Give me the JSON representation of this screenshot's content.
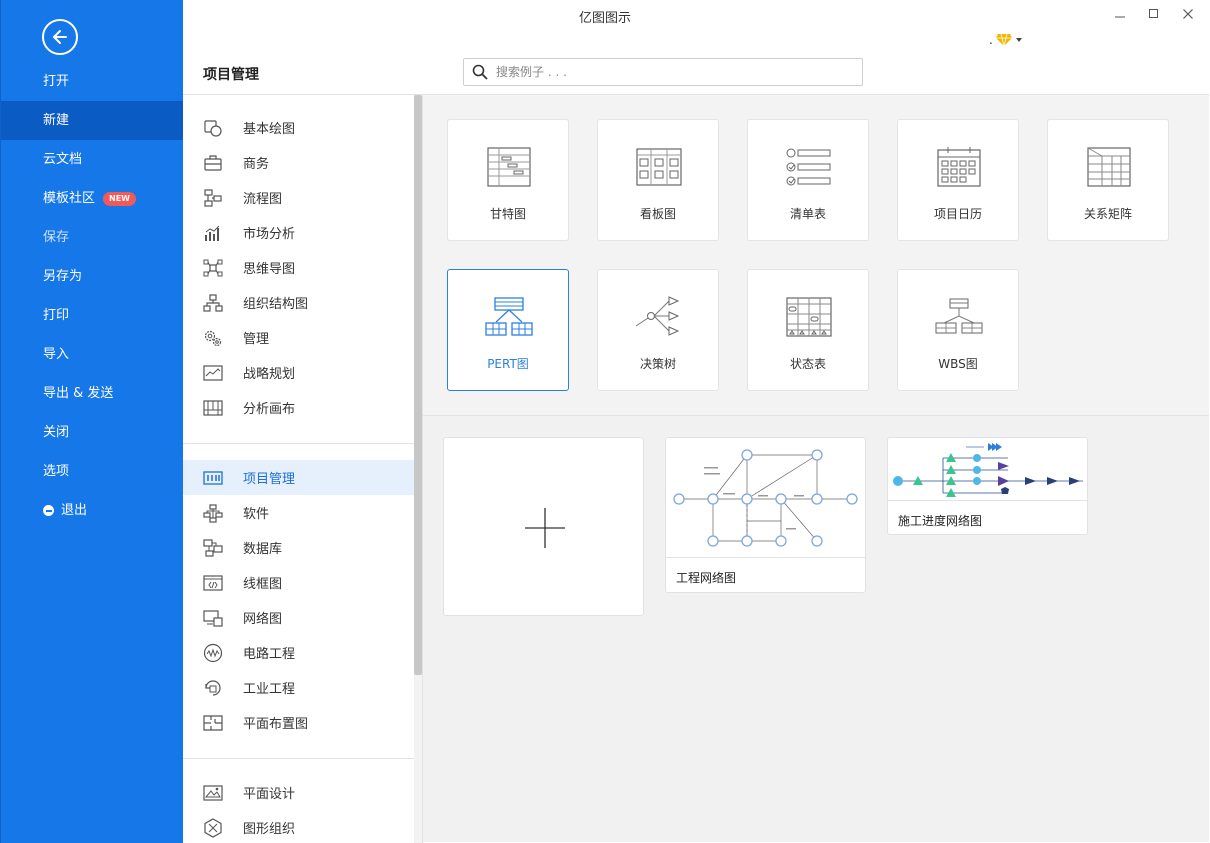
{
  "window": {
    "title": "亿图图示",
    "minimize_glyph": "—",
    "maximize_glyph": "☐",
    "close_glyph": "✕"
  },
  "premium": {
    "icon": "diamond-icon",
    "dot": ".",
    "color": "#f5b400"
  },
  "left_menu": {
    "back_icon": "back-arrow-icon",
    "items": [
      {
        "label": "打开"
      },
      {
        "label": "新建",
        "active": true
      },
      {
        "label": "云文档"
      },
      {
        "label": "模板社区",
        "badge": "NEW"
      },
      {
        "label": "保存",
        "dim": true
      },
      {
        "label": "另存为"
      },
      {
        "label": "打印"
      },
      {
        "label": "导入"
      },
      {
        "label": "导出 & 发送"
      },
      {
        "label": "关闭"
      },
      {
        "label": "选项"
      },
      {
        "label": "退出",
        "icon": "exit-icon"
      }
    ],
    "accent": "#1677e8"
  },
  "header": {
    "section_title": "项目管理",
    "search_placeholder": "搜索例子 . . ."
  },
  "categories": {
    "group1": [
      {
        "label": "基本绘图",
        "icon": "basic-shapes-icon"
      },
      {
        "label": "商务",
        "icon": "briefcase-icon"
      },
      {
        "label": "流程图",
        "icon": "flowchart-icon"
      },
      {
        "label": "市场分析",
        "icon": "bar-chart-icon"
      },
      {
        "label": "思维导图",
        "icon": "mindmap-icon"
      },
      {
        "label": "组织结构图",
        "icon": "org-chart-icon"
      },
      {
        "label": "管理",
        "icon": "gears-icon"
      },
      {
        "label": "战略规划",
        "icon": "line-chart-icon"
      },
      {
        "label": "分析画布",
        "icon": "canvas-icon"
      }
    ],
    "group2": [
      {
        "label": "项目管理",
        "icon": "gantt-icon",
        "active": true
      },
      {
        "label": "软件",
        "icon": "software-icon"
      },
      {
        "label": "数据库",
        "icon": "database-icon"
      },
      {
        "label": "线框图",
        "icon": "wireframe-icon"
      },
      {
        "label": "网络图",
        "icon": "network-icon"
      },
      {
        "label": "电路工程",
        "icon": "circuit-icon"
      },
      {
        "label": "工业工程",
        "icon": "industrial-icon"
      },
      {
        "label": "平面布置图",
        "icon": "floorplan-icon"
      }
    ],
    "group3": [
      {
        "label": "平面设计",
        "icon": "graphic-design-icon"
      },
      {
        "label": "图形组织",
        "icon": "graphic-organizer-icon"
      }
    ]
  },
  "templates": [
    {
      "label": "甘特图",
      "icon": "gantt-template-icon"
    },
    {
      "label": "看板图",
      "icon": "kanban-template-icon"
    },
    {
      "label": "清单表",
      "icon": "checklist-template-icon"
    },
    {
      "label": "项目日历",
      "icon": "calendar-template-icon"
    },
    {
      "label": "关系矩阵",
      "icon": "matrix-template-icon"
    },
    {
      "label": "PERT图",
      "icon": "pert-template-icon",
      "selected": true
    },
    {
      "label": "决策树",
      "icon": "decision-tree-template-icon"
    },
    {
      "label": "状态表",
      "icon": "status-table-template-icon"
    },
    {
      "label": "WBS图",
      "icon": "wbs-template-icon"
    }
  ],
  "examples": [
    {
      "label": "",
      "type": "new-blank",
      "icon": "plus-icon"
    },
    {
      "label": "工程网络图"
    },
    {
      "label": "施工进度网络图"
    }
  ]
}
